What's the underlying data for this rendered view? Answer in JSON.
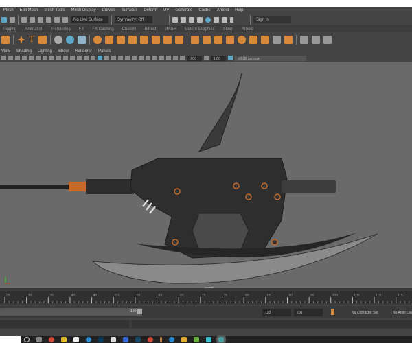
{
  "menubar": {
    "items": [
      "Mesh",
      "Edit Mesh",
      "Mesh Tools",
      "Mesh Display",
      "Curves",
      "Surfaces",
      "Deform",
      "UV",
      "Generate",
      "Cache",
      "Arnold",
      "Help"
    ]
  },
  "status": {
    "live_surface": "No Live Surface",
    "symmetry": "Symmetry: Off",
    "sign_in": "Sign In"
  },
  "shelf_tabs": [
    "Rigging",
    "Animation",
    "Rendering",
    "FX",
    "FX Caching",
    "Custom",
    "Bifrost",
    "MASH",
    "Motion Graphics",
    "XGen",
    "Arnold"
  ],
  "panel_menu": [
    "View",
    "Shading",
    "Lighting",
    "Show",
    "Renderer",
    "Panels"
  ],
  "panel_toolbar": {
    "exposure": "0.00",
    "gamma": "1.00",
    "color_space": "sRGB gamma"
  },
  "viewport": {
    "camera_label": "persp",
    "background": "#6a6a6a"
  },
  "timeline": {
    "ticks": [
      "25",
      "30",
      "35",
      "40",
      "45",
      "50",
      "55",
      "60",
      "65",
      "70",
      "75",
      "80",
      "85",
      "90",
      "95",
      "100",
      "105",
      "110",
      "115"
    ]
  },
  "range": {
    "range_end": "120",
    "end_time": "120",
    "max_time": "200",
    "character_set": "No Character Set",
    "anim_layer": "No Anim Layer"
  },
  "colors": {
    "accent": "#d8893a",
    "selected": "#5aa7c7"
  }
}
